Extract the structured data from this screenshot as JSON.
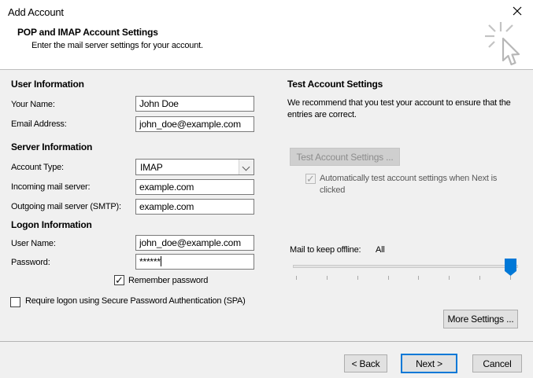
{
  "window": {
    "title": "Add Account"
  },
  "header": {
    "title": "POP and IMAP Account Settings",
    "subtitle": "Enter the mail server settings for your account."
  },
  "user_info": {
    "section_title": "User Information",
    "your_name_label": "Your Name:",
    "your_name_value": "John Doe",
    "email_label": "Email Address:",
    "email_value": "john_doe@example.com"
  },
  "server_info": {
    "section_title": "Server Information",
    "account_type_label": "Account Type:",
    "account_type_value": "IMAP",
    "incoming_label": "Incoming mail server:",
    "incoming_value": "example.com",
    "outgoing_label": "Outgoing mail server (SMTP):",
    "outgoing_value": "example.com"
  },
  "logon_info": {
    "section_title": "Logon Information",
    "username_label": "User Name:",
    "username_value": "john_doe@example.com",
    "password_label": "Password:",
    "password_value": "******",
    "remember_password_label": "Remember password",
    "remember_password_checked": true,
    "spa_label": "Require logon using Secure Password Authentication (SPA)",
    "spa_checked": false
  },
  "test_settings": {
    "section_title": "Test Account Settings",
    "description": "We recommend that you test your account to ensure that the entries are correct.",
    "test_button_label": "Test Account Settings ...",
    "test_button_enabled": false,
    "auto_test_label": "Automatically test account settings when Next is clicked",
    "auto_test_checked": true
  },
  "offline_mail": {
    "label": "Mail to keep offline:",
    "value": "All",
    "tick_count": 8
  },
  "more_settings_label": "More Settings ...",
  "footer": {
    "back_label": "< Back",
    "next_label": "Next >",
    "cancel_label": "Cancel"
  },
  "colors": {
    "accent": "#0078d7",
    "body_bg": "#f0f0f0",
    "header_bg": "#ffffff"
  }
}
